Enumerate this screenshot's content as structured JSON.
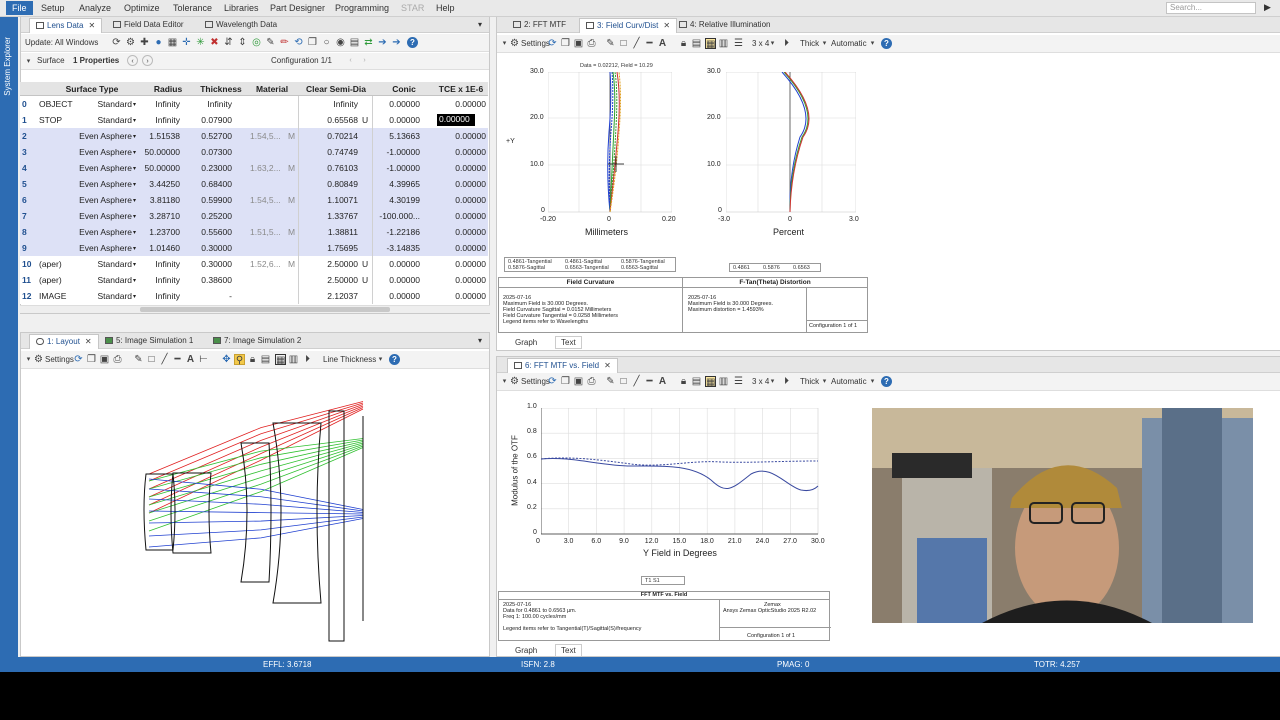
{
  "menubar": {
    "items": [
      "File",
      "Setup",
      "Analyze",
      "Optimize",
      "Tolerance",
      "Libraries",
      "Part Designer",
      "Programming",
      "STAR",
      "Help"
    ],
    "search_placeholder": "Search..."
  },
  "system_explorer_label": "System Explorer",
  "lens_panel": {
    "tabs": [
      "Lens Data",
      "Field Data Editor",
      "Wavelength Data"
    ],
    "update_label": "Update: All Windows",
    "surface_label": "Surface",
    "properties_label": "1 Properties",
    "configuration_label": "Configuration 1/1",
    "columns": [
      "Surface Type",
      "Radius",
      "Thickness",
      "Material",
      "Clear Semi-Dia",
      "Conic",
      "TCE x 1E-6"
    ],
    "rows": [
      {
        "num": "0",
        "name": "OBJECT",
        "type": "Standard",
        "radius": "Infinity",
        "thickness": "Infinity",
        "material": "",
        "semi": "Infinity",
        "semi_flag": "",
        "conic": "0.00000",
        "tce": "0.00000"
      },
      {
        "num": "1",
        "name": "STOP",
        "type": "Standard",
        "radius": "Infinity",
        "thickness": "0.07900",
        "material": "",
        "semi": "0.65568",
        "semi_flag": "U",
        "conic": "0.00000",
        "tce": "0.00000"
      },
      {
        "num": "2",
        "name": "",
        "type": "Even Asphere",
        "radius": "1.51538",
        "thickness": "0.52700",
        "material": "1.54,5...",
        "mat_flag": "M",
        "semi": "0.70214",
        "semi_flag": "",
        "conic": "5.13663",
        "tce": "0.00000"
      },
      {
        "num": "3",
        "name": "",
        "type": "Even Asphere",
        "radius": "50.00000",
        "thickness": "0.07300",
        "material": "",
        "semi": "0.74749",
        "semi_flag": "",
        "conic": "-1.00000",
        "tce": "0.00000"
      },
      {
        "num": "4",
        "name": "",
        "type": "Even Asphere",
        "radius": "50.00000",
        "thickness": "0.23000",
        "material": "1.63,2...",
        "mat_flag": "M",
        "semi": "0.76103",
        "semi_flag": "",
        "conic": "-1.00000",
        "tce": "0.00000"
      },
      {
        "num": "5",
        "name": "",
        "type": "Even Asphere",
        "radius": "3.44250",
        "thickness": "0.68400",
        "material": "",
        "semi": "0.80849",
        "semi_flag": "",
        "conic": "4.39965",
        "tce": "0.00000"
      },
      {
        "num": "6",
        "name": "",
        "type": "Even Asphere",
        "radius": "3.81180",
        "thickness": "0.59900",
        "material": "1.54,5...",
        "mat_flag": "M",
        "semi": "1.10071",
        "semi_flag": "",
        "conic": "4.30199",
        "tce": "0.00000"
      },
      {
        "num": "7",
        "name": "",
        "type": "Even Asphere",
        "radius": "3.28710",
        "thickness": "0.25200",
        "material": "",
        "semi": "1.33767",
        "semi_flag": "",
        "conic": "-100.000...",
        "tce": "0.00000"
      },
      {
        "num": "8",
        "name": "",
        "type": "Even Asphere",
        "radius": "1.23700",
        "thickness": "0.55600",
        "material": "1.51,5...",
        "mat_flag": "M",
        "semi": "1.38811",
        "semi_flag": "",
        "conic": "-1.22186",
        "tce": "0.00000"
      },
      {
        "num": "9",
        "name": "",
        "type": "Even Asphere",
        "radius": "1.01460",
        "thickness": "0.30000",
        "material": "",
        "semi": "1.75695",
        "semi_flag": "",
        "conic": "-3.14835",
        "tce": "0.00000"
      },
      {
        "num": "10",
        "name": "(aper)",
        "type": "Standard",
        "radius": "Infinity",
        "thickness": "0.30000",
        "material": "1.52,6...",
        "mat_flag": "M",
        "semi": "2.50000",
        "semi_flag": "U",
        "conic": "0.00000",
        "tce": "0.00000"
      },
      {
        "num": "11",
        "name": "(aper)",
        "type": "Standard",
        "radius": "Infinity",
        "thickness": "0.38600",
        "material": "",
        "semi": "2.50000",
        "semi_flag": "U",
        "conic": "0.00000",
        "tce": "0.00000"
      },
      {
        "num": "12",
        "name": "IMAGE",
        "type": "Standard",
        "radius": "Infinity",
        "thickness": "-",
        "material": "",
        "semi": "2.12037",
        "semi_flag": "",
        "conic": "0.00000",
        "tce": "0.00000"
      }
    ]
  },
  "layout_panel": {
    "tabs": [
      "1: Layout",
      "5: Image Simulation 1",
      "7: Image Simulation 2"
    ],
    "settings_label": "Settings",
    "line_thickness_label": "Line Thickness"
  },
  "fc_panel": {
    "tabs": [
      "2: FFT MTF",
      "3: Field Curv/Dist",
      "4: Relative Illumination"
    ],
    "settings_label": "Settings",
    "grid_label": "3 x 4",
    "thick_label": "Thick",
    "auto_label": "Automatic",
    "data_line": "Data = 0.02212, Field = 10.29",
    "fc_y_label": "+Y",
    "fc_x_label": "Millimeters",
    "dist_x_label": "Percent",
    "fc_y_ticks": [
      "30.0",
      "20.0",
      "10.0",
      "0"
    ],
    "fc_x_ticks": [
      "-0.20",
      "0",
      "0.20"
    ],
    "dist_y_ticks": [
      "30.0",
      "20.0",
      "10.0",
      "0"
    ],
    "dist_x_ticks": [
      "-3.0",
      "0",
      "3.0"
    ],
    "fc_legend": [
      "0.4861-Tangential",
      "0.4861-Sagittal",
      "0.5876-Tangential",
      "0.5876-Sagittal",
      "0.6563-Tangential",
      "0.6563-Sagittal"
    ],
    "dist_legend": [
      "0.4861",
      "0.5876",
      "0.6563"
    ],
    "fc_info_title": "Field Curvature",
    "fc_info_lines": [
      "2025-07-16",
      "Maximum Field is 30.000 Degrees.",
      "Field Curvature Sagittal = 0.0152 Millimeters",
      "Field Curvature Tangential = 0.0258 Millimeters",
      "Legend items refer to Wavelengths"
    ],
    "dist_info_title": "F-Tan(Theta) Distortion",
    "dist_info_lines": [
      "2025-07-16",
      "Maximum Field is 30.000 Degrees.",
      "Maximum distortion = 1.4593%"
    ],
    "config_label": "Configuration 1 of 1",
    "bottom_tabs": [
      "Graph",
      "Text"
    ]
  },
  "mtf_panel": {
    "tab": "6: FFT MTF vs. Field",
    "settings_label": "Settings",
    "grid_label": "3 x 4",
    "thick_label": "Thick",
    "auto_label": "Automatic",
    "y_label": "Modulus of the OTF",
    "x_label": "Y Field in Degrees",
    "y_ticks": [
      "1.0",
      "0.8",
      "0.6",
      "0.4",
      "0.2",
      "0"
    ],
    "x_ticks": [
      "0",
      "3.0",
      "6.0",
      "9.0",
      "12.0",
      "15.0",
      "18.0",
      "21.0",
      "24.0",
      "27.0",
      "30.0"
    ],
    "legend": "T1   S1",
    "info_title": "FFT MTF vs. Field",
    "info_lines": [
      "2025-07-16",
      "Data for 0.4861 to 0.6563 µm.",
      "Freq 1: 100.00 cycles/mm",
      "",
      "Legend items refer to Tangential(T)/Sagittal(S)/frequency"
    ],
    "brand_lines": [
      "Zemax",
      "Ansys Zemax OpticStudio 2025 R2.02"
    ],
    "config_label": "Configuration 1 of 1",
    "bottom_tabs": [
      "Graph",
      "Text"
    ]
  },
  "statusbar": {
    "effl": "EFFL: 3.6718",
    "isfn": "ISFN: 2.8",
    "pmag": "PMAG: 0",
    "totr": "TOTR: 4.257"
  },
  "colors": {
    "accent": "#2d6cb3",
    "selected_row": "#dde1f6",
    "ray_red": "#e02020",
    "ray_green": "#30c030",
    "ray_blue": "#2040d0"
  }
}
